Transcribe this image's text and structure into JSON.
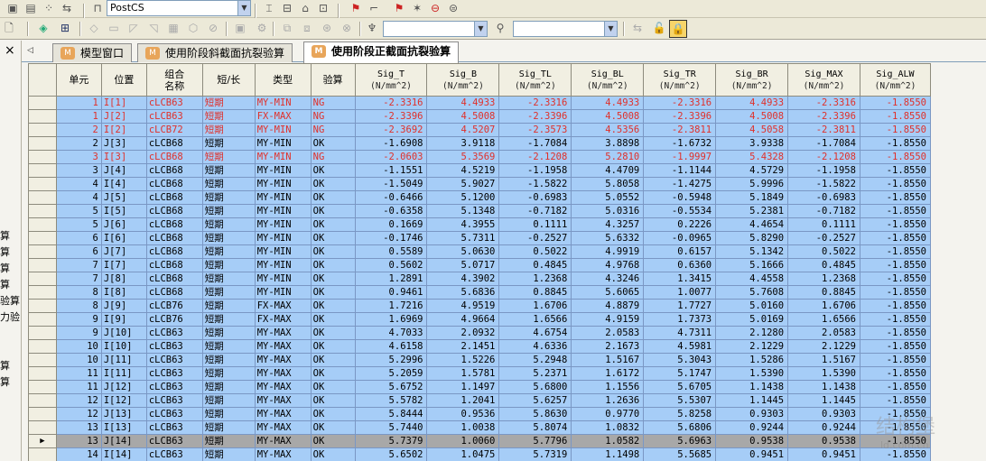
{
  "toolbar": {
    "postcs_combo": "PostCS",
    "combo2_value": "",
    "combo3_value": ""
  },
  "left_panel": {
    "close": "×",
    "items": [
      "算",
      "算",
      "算",
      "算",
      "验算",
      "力验",
      "算",
      "算"
    ]
  },
  "tabs": [
    {
      "label": "模型窗口",
      "active": false
    },
    {
      "label": "使用阶段斜截面抗裂验算",
      "active": false
    },
    {
      "label": "使用阶段正截面抗裂验算",
      "active": true
    }
  ],
  "table": {
    "headers": {
      "unit": "单元",
      "position": "位置",
      "combo_l1": "组合",
      "combo_l2": "名称",
      "term": "短/长",
      "type": "类型",
      "check": "验算",
      "sig_t": "Sig_T",
      "sig_b": "Sig_B",
      "sig_tl": "Sig_TL",
      "sig_bl": "Sig_BL",
      "sig_tr": "Sig_TR",
      "sig_br": "Sig_BR",
      "sig_max": "Sig_MAX",
      "sig_alw": "Sig_ALW",
      "stress_unit": "(N/mm^2)"
    },
    "rows": [
      [
        "1",
        "I[1]",
        "cLCB63",
        "短期",
        "MY-MIN",
        "NG",
        "-2.3316",
        "4.4933",
        "-2.3316",
        "4.4933",
        "-2.3316",
        "4.4933",
        "-2.3316",
        "-1.8550"
      ],
      [
        "1",
        "J[2]",
        "cLCB63",
        "短期",
        "FX-MAX",
        "NG",
        "-2.3396",
        "4.5008",
        "-2.3396",
        "4.5008",
        "-2.3396",
        "4.5008",
        "-2.3396",
        "-1.8550"
      ],
      [
        "2",
        "I[2]",
        "cLCB72",
        "短期",
        "MY-MIN",
        "NG",
        "-2.3692",
        "4.5207",
        "-2.3573",
        "4.5356",
        "-2.3811",
        "4.5058",
        "-2.3811",
        "-1.8550"
      ],
      [
        "2",
        "J[3]",
        "cLCB68",
        "短期",
        "MY-MIN",
        "OK",
        "-1.6908",
        "3.9118",
        "-1.7084",
        "3.8898",
        "-1.6732",
        "3.9338",
        "-1.7084",
        "-1.8550"
      ],
      [
        "3",
        "I[3]",
        "cLCB68",
        "短期",
        "MY-MIN",
        "NG",
        "-2.0603",
        "5.3569",
        "-2.1208",
        "5.2810",
        "-1.9997",
        "5.4328",
        "-2.1208",
        "-1.8550"
      ],
      [
        "3",
        "J[4]",
        "cLCB68",
        "短期",
        "MY-MIN",
        "OK",
        "-1.1551",
        "4.5219",
        "-1.1958",
        "4.4709",
        "-1.1144",
        "4.5729",
        "-1.1958",
        "-1.8550"
      ],
      [
        "4",
        "I[4]",
        "cLCB68",
        "短期",
        "MY-MIN",
        "OK",
        "-1.5049",
        "5.9027",
        "-1.5822",
        "5.8058",
        "-1.4275",
        "5.9996",
        "-1.5822",
        "-1.8550"
      ],
      [
        "4",
        "J[5]",
        "cLCB68",
        "短期",
        "MY-MIN",
        "OK",
        "-0.6466",
        "5.1200",
        "-0.6983",
        "5.0552",
        "-0.5948",
        "5.1849",
        "-0.6983",
        "-1.8550"
      ],
      [
        "5",
        "I[5]",
        "cLCB68",
        "短期",
        "MY-MIN",
        "OK",
        "-0.6358",
        "5.1348",
        "-0.7182",
        "5.0316",
        "-0.5534",
        "5.2381",
        "-0.7182",
        "-1.8550"
      ],
      [
        "5",
        "J[6]",
        "cLCB68",
        "短期",
        "MY-MIN",
        "OK",
        "0.1669",
        "4.3955",
        "0.1111",
        "4.3257",
        "0.2226",
        "4.4654",
        "0.1111",
        "-1.8550"
      ],
      [
        "6",
        "I[6]",
        "cLCB68",
        "短期",
        "MY-MIN",
        "OK",
        "-0.1746",
        "5.7311",
        "-0.2527",
        "5.6332",
        "-0.0965",
        "5.8290",
        "-0.2527",
        "-1.8550"
      ],
      [
        "6",
        "J[7]",
        "cLCB68",
        "短期",
        "MY-MIN",
        "OK",
        "0.5589",
        "5.0630",
        "0.5022",
        "4.9919",
        "0.6157",
        "5.1342",
        "0.5022",
        "-1.8550"
      ],
      [
        "7",
        "I[7]",
        "cLCB68",
        "短期",
        "MY-MIN",
        "OK",
        "0.5602",
        "5.0717",
        "0.4845",
        "4.9768",
        "0.6360",
        "5.1666",
        "0.4845",
        "-1.8550"
      ],
      [
        "7",
        "J[8]",
        "cLCB68",
        "短期",
        "MY-MIN",
        "OK",
        "1.2891",
        "4.3902",
        "1.2368",
        "4.3246",
        "1.3415",
        "4.4558",
        "1.2368",
        "-1.8550"
      ],
      [
        "8",
        "I[8]",
        "cLCB68",
        "短期",
        "MY-MIN",
        "OK",
        "0.9461",
        "5.6836",
        "0.8845",
        "5.6065",
        "1.0077",
        "5.7608",
        "0.8845",
        "-1.8550"
      ],
      [
        "8",
        "J[9]",
        "cLCB76",
        "短期",
        "FX-MAX",
        "OK",
        "1.7216",
        "4.9519",
        "1.6706",
        "4.8879",
        "1.7727",
        "5.0160",
        "1.6706",
        "-1.8550"
      ],
      [
        "9",
        "I[9]",
        "cLCB76",
        "短期",
        "FX-MAX",
        "OK",
        "1.6969",
        "4.9664",
        "1.6566",
        "4.9159",
        "1.7373",
        "5.0169",
        "1.6566",
        "-1.8550"
      ],
      [
        "9",
        "J[10]",
        "cLCB63",
        "短期",
        "MY-MAX",
        "OK",
        "4.7033",
        "2.0932",
        "4.6754",
        "2.0583",
        "4.7311",
        "2.1280",
        "2.0583",
        "-1.8550"
      ],
      [
        "10",
        "I[10]",
        "cLCB63",
        "短期",
        "MY-MAX",
        "OK",
        "4.6158",
        "2.1451",
        "4.6336",
        "2.1673",
        "4.5981",
        "2.1229",
        "2.1229",
        "-1.8550"
      ],
      [
        "10",
        "J[11]",
        "cLCB63",
        "短期",
        "MY-MAX",
        "OK",
        "5.2996",
        "1.5226",
        "5.2948",
        "1.5167",
        "5.3043",
        "1.5286",
        "1.5167",
        "-1.8550"
      ],
      [
        "11",
        "I[11]",
        "cLCB63",
        "短期",
        "MY-MAX",
        "OK",
        "5.2059",
        "1.5781",
        "5.2371",
        "1.6172",
        "5.1747",
        "1.5390",
        "1.5390",
        "-1.8550"
      ],
      [
        "11",
        "J[12]",
        "cLCB63",
        "短期",
        "MY-MAX",
        "OK",
        "5.6752",
        "1.1497",
        "5.6800",
        "1.1556",
        "5.6705",
        "1.1438",
        "1.1438",
        "-1.8550"
      ],
      [
        "12",
        "I[12]",
        "cLCB63",
        "短期",
        "MY-MAX",
        "OK",
        "5.5782",
        "1.2041",
        "5.6257",
        "1.2636",
        "5.5307",
        "1.1445",
        "1.1445",
        "-1.8550"
      ],
      [
        "12",
        "J[13]",
        "cLCB63",
        "短期",
        "MY-MAX",
        "OK",
        "5.8444",
        "0.9536",
        "5.8630",
        "0.9770",
        "5.8258",
        "0.9303",
        "0.9303",
        "-1.8550"
      ],
      [
        "13",
        "I[13]",
        "cLCB63",
        "短期",
        "MY-MAX",
        "OK",
        "5.7440",
        "1.0038",
        "5.8074",
        "1.0832",
        "5.6806",
        "0.9244",
        "0.9244",
        "-1.8550"
      ],
      [
        "13",
        "J[14]",
        "cLCB63",
        "短期",
        "MY-MAX",
        "OK",
        "5.7379",
        "1.0060",
        "5.7796",
        "1.0582",
        "5.6963",
        "0.9538",
        "0.9538",
        "-1.8550"
      ],
      [
        "14",
        "I[14]",
        "cLCB63",
        "短期",
        "MY-MAX",
        "OK",
        "5.6502",
        "1.0475",
        "5.7319",
        "1.1498",
        "5.5685",
        "0.9451",
        "0.9451",
        "-1.8550"
      ]
    ],
    "selected_row": 25,
    "current_row_marker": "▶"
  },
  "watermark": {
    "main": "结构堡",
    "url": "ld.com.cn"
  }
}
